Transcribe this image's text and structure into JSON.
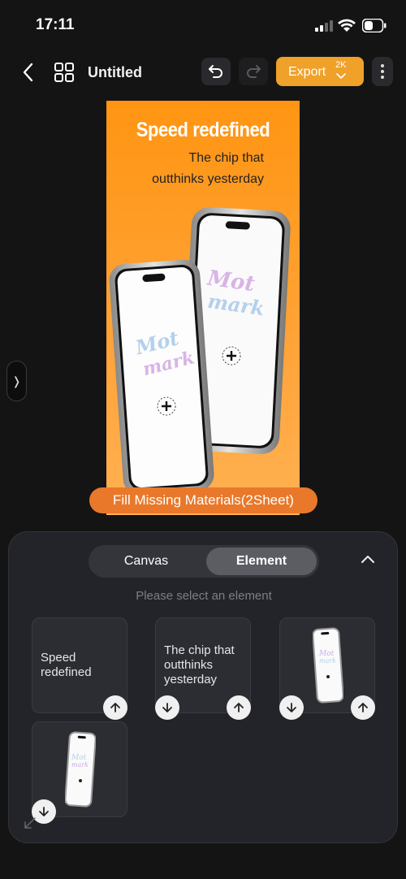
{
  "status_bar": {
    "time": "17:11"
  },
  "header": {
    "title": "Untitled",
    "export_label": "Export",
    "export_resolution": "2K"
  },
  "poster": {
    "headline": "Speed redefined",
    "subline_1": "The chip that",
    "subline_2": "outthinks yesterday",
    "logo_text": "Mot mark",
    "background_color": "#ff9a1f"
  },
  "fill_missing_label": "Fill Missing Materials(2Sheet)",
  "panel": {
    "tabs": [
      {
        "label": "Canvas",
        "selected": false
      },
      {
        "label": "Element",
        "selected": true
      }
    ],
    "hint": "Please select an element",
    "elements": [
      {
        "type": "text",
        "text": "Speed redefined",
        "actions": [
          "move-up"
        ]
      },
      {
        "type": "text",
        "text": "The chip that outthinks yesterday",
        "actions": [
          "move-down",
          "move-up"
        ]
      },
      {
        "type": "image",
        "icon": "phone-image",
        "actions": [
          "move-down",
          "move-up"
        ]
      },
      {
        "type": "image",
        "icon": "phone-image",
        "actions": [
          "move-down"
        ]
      }
    ]
  },
  "colors": {
    "accent": "#f0a12a",
    "pill": "#e9782a",
    "panel": "#23242a"
  }
}
